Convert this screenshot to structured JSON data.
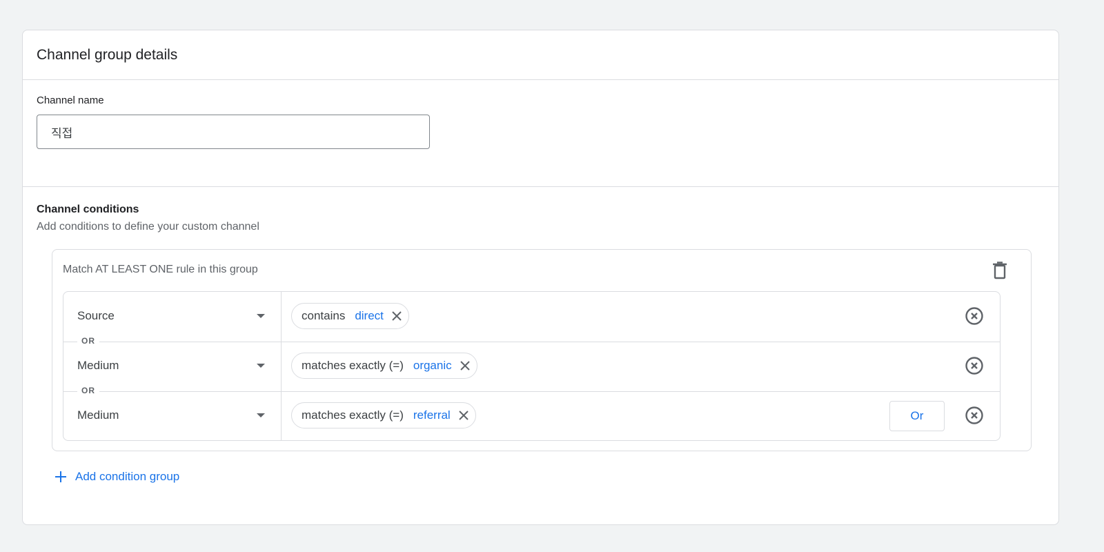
{
  "card": {
    "title": "Channel group details"
  },
  "name_section": {
    "label": "Channel name",
    "value": "직접"
  },
  "conditions": {
    "title": "Channel conditions",
    "subtitle": "Add conditions to define your custom channel",
    "group": {
      "label": "Match AT LEAST ONE rule in this group",
      "or_separator": "OR",
      "rules": [
        {
          "dimension": "Source",
          "operator": "contains",
          "value": "direct"
        },
        {
          "dimension": "Medium",
          "operator": "matches exactly (=)",
          "value": "organic"
        },
        {
          "dimension": "Medium",
          "operator": "matches exactly (=)",
          "value": "referral"
        }
      ],
      "or_button_label": "Or"
    },
    "add_group_label": "Add condition group"
  },
  "colors": {
    "accent": "#1a73e8",
    "border": "#dadce0",
    "background": "#f1f3f4"
  },
  "icons": {
    "delete_group": "trash-icon",
    "remove_value": "close-icon",
    "remove_rule": "circle-close-icon",
    "dropdown": "caret-down-icon",
    "add": "plus-icon"
  }
}
